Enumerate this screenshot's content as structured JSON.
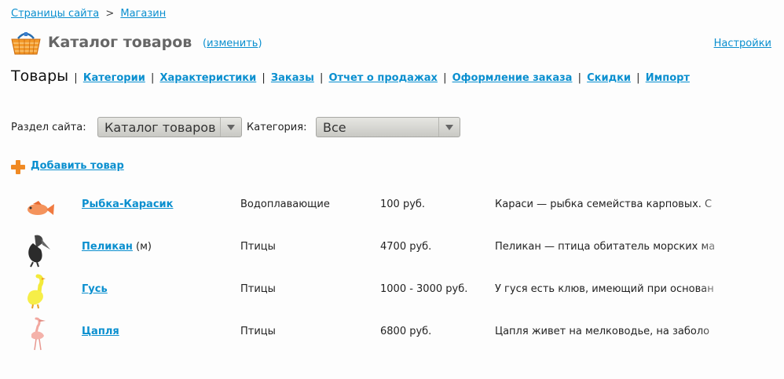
{
  "breadcrumb": {
    "home": "Страницы сайта",
    "separator": ">",
    "current": "Магазин"
  },
  "header": {
    "title": "Каталог товаров",
    "change_open": "(",
    "change_label": "изменить",
    "change_close": ")",
    "settings_label": "Настройки",
    "icon": "basket-icon"
  },
  "tabs": {
    "current": "Товары",
    "separator": "|",
    "links": [
      "Категории",
      "Характеристики",
      "Заказы",
      "Отчет о продажах",
      "Оформление заказа",
      "Скидки",
      "Импорт"
    ]
  },
  "filters": {
    "section_label": "Раздел сайта:",
    "section_value": "Каталог товаров",
    "category_label": "Категория:",
    "category_value": "Все"
  },
  "add_product": {
    "label": "Добавить товар",
    "icon": "plus-icon"
  },
  "products": [
    {
      "name": "Рыбка-Карасик",
      "note": "",
      "category": "Водоплавающие",
      "price": "100 руб.",
      "description": "Караси — рыбка семейства карповых. С",
      "icon": "fish-icon"
    },
    {
      "name": "Пеликан",
      "note": "(м)",
      "category": "Птицы",
      "price": "4700 руб.",
      "description": "Пеликан — птица обитатель морских ма",
      "icon": "pelican-icon"
    },
    {
      "name": "Гусь",
      "note": "",
      "category": "Птицы",
      "price": "1000 - 3000 руб.",
      "description": "У гуся есть клюв, имеющий при основан",
      "icon": "goose-icon"
    },
    {
      "name": "Цапля",
      "note": "",
      "category": "Птицы",
      "price": "6800 руб.",
      "description": "Цапля живет на мелководье, на заболо",
      "icon": "heron-icon"
    }
  ],
  "colors": {
    "link": "#0a8fcf",
    "accent": "#f08a24",
    "title": "#666666"
  }
}
